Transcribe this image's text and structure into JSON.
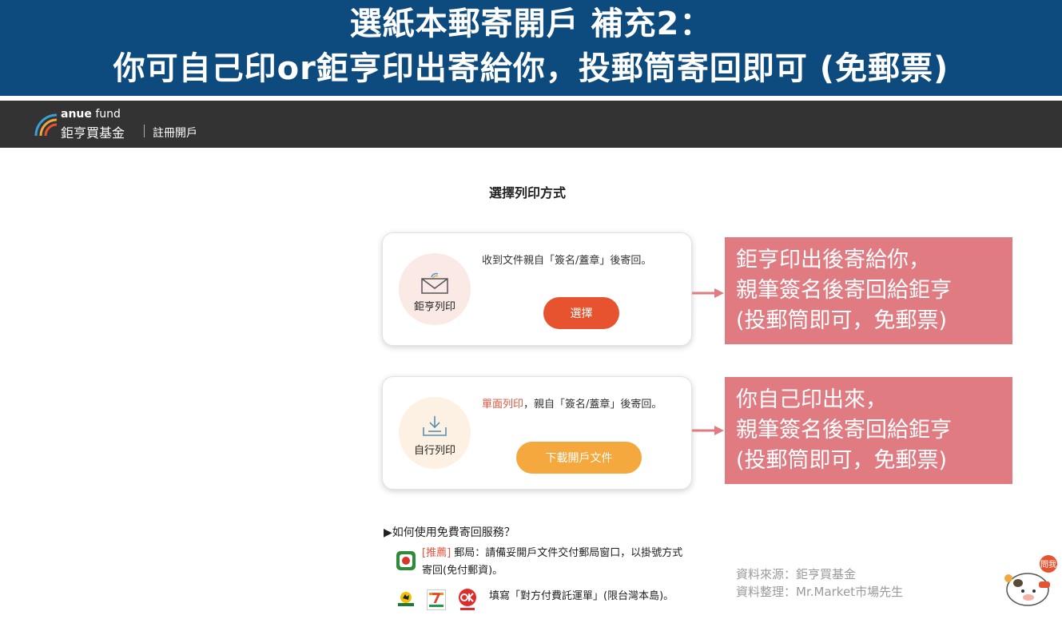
{
  "banner": {
    "line1": "選紙本郵寄開戶 補充2：",
    "line2": "你可自己印or鉅亨印出寄給你，投郵筒寄回即可 (免郵票)"
  },
  "topbar": {
    "brand_en_bold": "anue",
    "brand_en_thin": " fund",
    "brand_zh": "鉅亨買基金",
    "register": "註冊開戶"
  },
  "main": {
    "title": "選擇列印方式",
    "cards": [
      {
        "label": "鉅亨列印",
        "icon": "mail-icon",
        "desc": "收到文件親自「簽名/蓋章」後寄回。",
        "button": "選擇"
      },
      {
        "label": "自行列印",
        "icon": "download-tray-icon",
        "desc_highlight": "單面列印",
        "desc": "，親自「簽名/蓋章」後寄回。",
        "button": "下載開戶文件"
      }
    ],
    "faq": {
      "title": "▶如何使用免費寄回服務？",
      "item1_tag": "[推薦]",
      "item1_text": " 郵局：請備妥開戶文件交付郵局窗口，以掛號方式寄回(免付郵資)。",
      "item2_text": "填寫「對方付費託運單」(限台灣本島)。"
    }
  },
  "notes": [
    {
      "line1": "鉅亨印出後寄給你，",
      "line2": "親筆簽名後寄回給鉅亨",
      "line3": "(投郵筒即可，免郵票)"
    },
    {
      "line1": "你自己印出來，",
      "line2": "親筆簽名後寄回給鉅亨",
      "line3": "(投郵筒即可，免郵票)"
    }
  ],
  "credits": {
    "source": "資料來源：鉅亨買基金",
    "compiled": "資料整理：Mr.Market市場先生"
  },
  "mascot": {
    "badge": "問我"
  },
  "colors": {
    "banner_bg": "#0d4a7e",
    "topbar_bg": "#333333",
    "accent_red": "#e8532f",
    "accent_orange": "#f5a83e",
    "note_bg": "#e07b82",
    "arrow": "#e07b82"
  }
}
